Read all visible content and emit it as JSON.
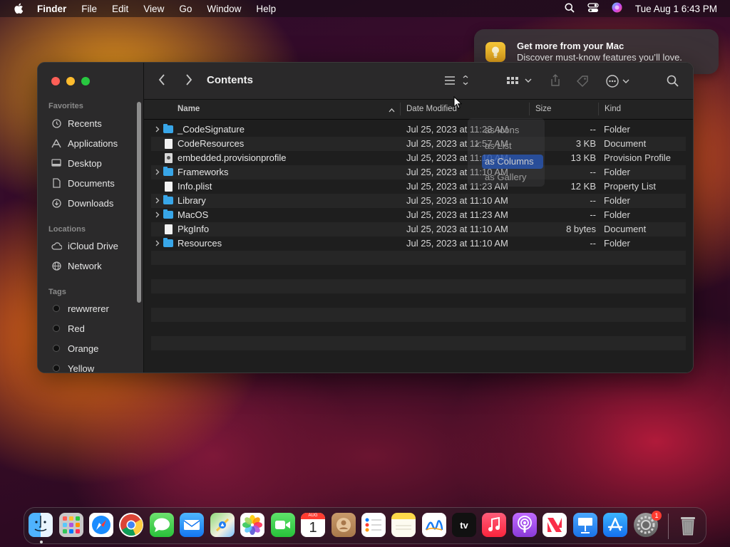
{
  "menubar": {
    "app_name": "Finder",
    "menus": [
      "File",
      "Edit",
      "View",
      "Go",
      "Window",
      "Help"
    ],
    "clock": "Tue Aug 1  6:43 PM"
  },
  "notification": {
    "title": "Get more from your Mac",
    "body": "Discover must-know features you’ll love."
  },
  "window": {
    "title": "Contents",
    "sidebar": {
      "favorites_label": "Favorites",
      "favorites": [
        "Recents",
        "Applications",
        "Desktop",
        "Documents",
        "Downloads"
      ],
      "locations_label": "Locations",
      "locations": [
        "iCloud Drive",
        "Network"
      ],
      "tags_label": "Tags",
      "tags": [
        "rewwrerer",
        "Red",
        "Orange",
        "Yellow"
      ]
    },
    "columns": {
      "name": "Name",
      "date": "Date Modified",
      "size": "Size",
      "kind": "Kind"
    },
    "files": [
      {
        "name": "_CodeSignature",
        "date": "Jul 25, 2023 at 11:23 AM",
        "size": "--",
        "kind": "Folder",
        "type": "folder"
      },
      {
        "name": "CodeResources",
        "date": "Jul 25, 2023 at 11:57 AM",
        "size": "3 KB",
        "kind": "Document",
        "type": "doc"
      },
      {
        "name": "embedded.provisionprofile",
        "date": "Jul 25, 2023 at 11:10 AM",
        "size": "13 KB",
        "kind": "Provision Profile",
        "type": "prov"
      },
      {
        "name": "Frameworks",
        "date": "Jul 25, 2023 at 11:10 AM",
        "size": "--",
        "kind": "Folder",
        "type": "folder"
      },
      {
        "name": "Info.plist",
        "date": "Jul 25, 2023 at 11:23 AM",
        "size": "12 KB",
        "kind": "Property List",
        "type": "doc"
      },
      {
        "name": "Library",
        "date": "Jul 25, 2023 at 11:10 AM",
        "size": "--",
        "kind": "Folder",
        "type": "folder"
      },
      {
        "name": "MacOS",
        "date": "Jul 25, 2023 at 11:23 AM",
        "size": "--",
        "kind": "Folder",
        "type": "folder"
      },
      {
        "name": "PkgInfo",
        "date": "Jul 25, 2023 at 11:10 AM",
        "size": "8 bytes",
        "kind": "Document",
        "type": "doc"
      },
      {
        "name": "Resources",
        "date": "Jul 25, 2023 at 11:10 AM",
        "size": "--",
        "kind": "Folder",
        "type": "folder"
      }
    ],
    "view_menu": {
      "options": [
        "as Icons",
        "as List",
        "as Columns",
        "as Gallery"
      ],
      "checked": "as List",
      "highlighted": "as Columns"
    }
  },
  "dock": {
    "apps": [
      "Finder",
      "Launchpad",
      "Safari",
      "Chrome",
      "Messages",
      "Mail",
      "Maps",
      "Photos",
      "FaceTime",
      "Calendar",
      "Contacts",
      "Reminders",
      "Notes",
      "Freeform",
      "TV",
      "Music",
      "Podcasts",
      "News",
      "Keynote",
      "App Store",
      "System Settings",
      "Trash"
    ],
    "calendar_month": "AUG",
    "calendar_day": "1",
    "tv_label": "tv",
    "settings_badge": "1"
  },
  "colors": {
    "accent": "#2f6fd6",
    "folder": "#38a6e8",
    "close": "#fe5f57",
    "minimize": "#febc2e",
    "zoom": "#28c840"
  }
}
